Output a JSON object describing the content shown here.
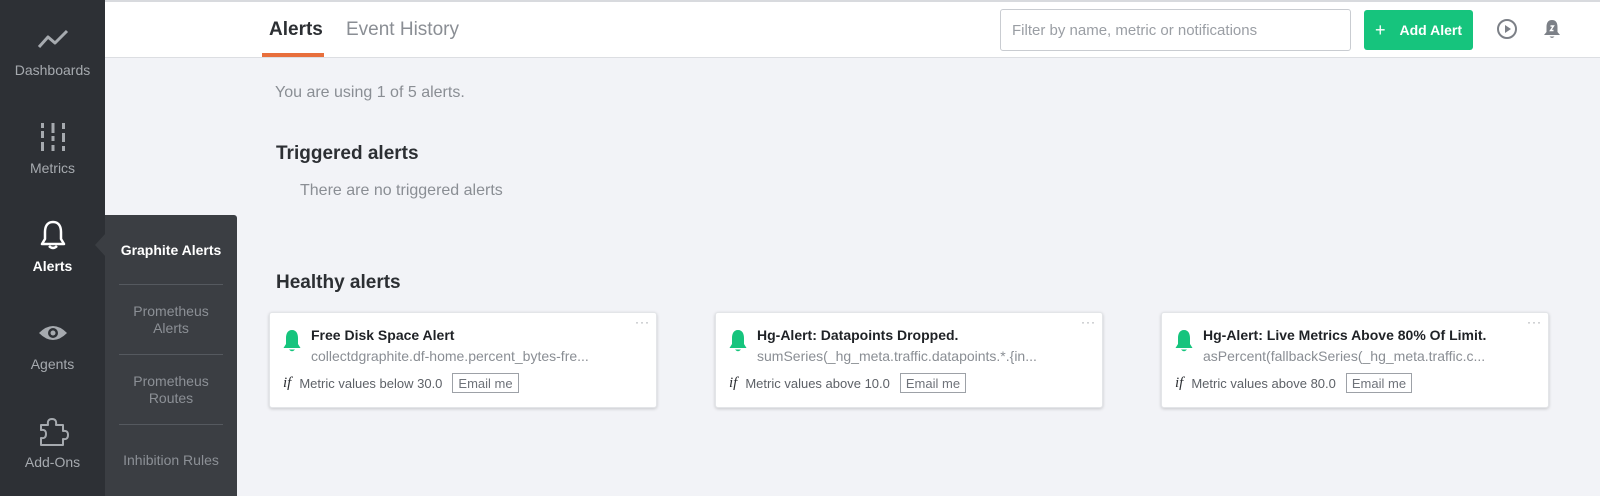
{
  "sidebar": {
    "items": [
      {
        "label": "Dashboards",
        "icon": "chart-line-icon"
      },
      {
        "label": "Metrics",
        "icon": "metrics-icon"
      },
      {
        "label": "Alerts",
        "icon": "bell-icon",
        "active": true
      },
      {
        "label": "Agents",
        "icon": "eye-icon"
      },
      {
        "label": "Add-Ons",
        "icon": "puzzle-icon"
      }
    ]
  },
  "submenu": {
    "items": [
      {
        "label": "Graphite Alerts",
        "active": true
      },
      {
        "label": "Prometheus Alerts"
      },
      {
        "label": "Prometheus Routes"
      },
      {
        "label": "Inhibition Rules"
      }
    ]
  },
  "header": {
    "tabs": [
      {
        "label": "Alerts",
        "active": true
      },
      {
        "label": "Event History"
      }
    ],
    "filter_placeholder": "Filter by name, metric or notifications",
    "add_button_icon": "+",
    "add_button_label": "Add Alert"
  },
  "main": {
    "usage_text": "You are using 1 of 5 alerts.",
    "triggered_title": "Triggered alerts",
    "triggered_empty": "There are no triggered alerts",
    "healthy_title": "Healthy alerts",
    "alerts": [
      {
        "title": "Free Disk Space Alert",
        "metric": "collectdgraphite.df-home.percent_bytes-fre...",
        "if_label": "if",
        "condition": "Metric values below 30.0",
        "notification": "Email me"
      },
      {
        "title": "Hg-Alert: Datapoints Dropped.",
        "metric": "sumSeries(_hg_meta.traffic.datapoints.*.{in...",
        "if_label": "if",
        "condition": "Metric values above 10.0",
        "notification": "Email me"
      },
      {
        "title": "Hg-Alert: Live Metrics Above 80% Of Limit.",
        "metric": "asPercent(fallbackSeries(_hg_meta.traffic.c...",
        "if_label": "if",
        "condition": "Metric values above 80.0",
        "notification": "Email me"
      }
    ],
    "more_glyph": "···"
  },
  "colors": {
    "sidebar_bg": "#2d3035",
    "accent_orange": "#e86f3c",
    "accent_green": "#16c47d"
  }
}
